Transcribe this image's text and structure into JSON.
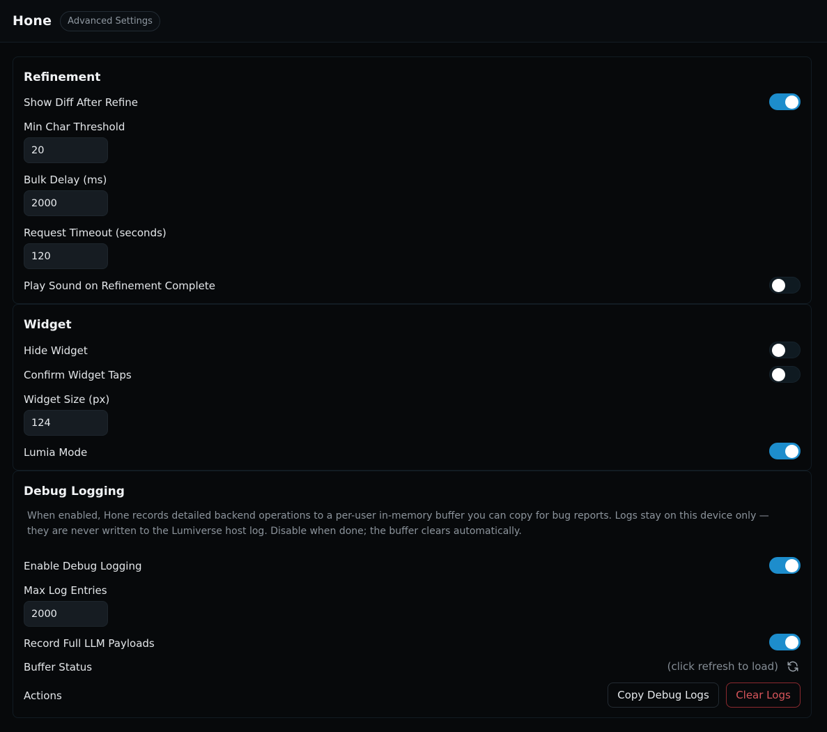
{
  "header": {
    "title": "Hone",
    "badge": "Advanced Settings"
  },
  "refinement": {
    "title": "Refinement",
    "show_diff": {
      "label": "Show Diff After Refine",
      "on": true
    },
    "min_char": {
      "label": "Min Char Threshold",
      "value": "20"
    },
    "bulk_delay": {
      "label": "Bulk Delay (ms)",
      "value": "2000"
    },
    "timeout": {
      "label": "Request Timeout (seconds)",
      "value": "120"
    },
    "play_sound": {
      "label": "Play Sound on Refinement Complete",
      "on": false
    }
  },
  "widget": {
    "title": "Widget",
    "hide": {
      "label": "Hide Widget",
      "on": false
    },
    "confirm": {
      "label": "Confirm Widget Taps",
      "on": false
    },
    "size": {
      "label": "Widget Size (px)",
      "value": "124"
    },
    "lumia": {
      "label": "Lumia Mode",
      "on": true
    }
  },
  "debug": {
    "title": "Debug Logging",
    "description": "When enabled, Hone records detailed backend operations to a per-user in-memory buffer you can copy for bug reports. Logs stay on this device only — they are never written to the Lumiverse host log. Disable when done; the buffer clears automatically.",
    "enable": {
      "label": "Enable Debug Logging",
      "on": true
    },
    "max_entries": {
      "label": "Max Log Entries",
      "value": "2000"
    },
    "full_payloads": {
      "label": "Record Full LLM Payloads",
      "on": true
    },
    "buffer_status": {
      "label": "Buffer Status",
      "value": "(click refresh to load)",
      "icon": "refresh-icon"
    },
    "actions": {
      "label": "Actions",
      "copy": "Copy Debug Logs",
      "clear": "Clear Logs"
    }
  },
  "colors": {
    "accent": "#1d8dcc",
    "danger": "#d8555b",
    "background": "#07090b"
  }
}
